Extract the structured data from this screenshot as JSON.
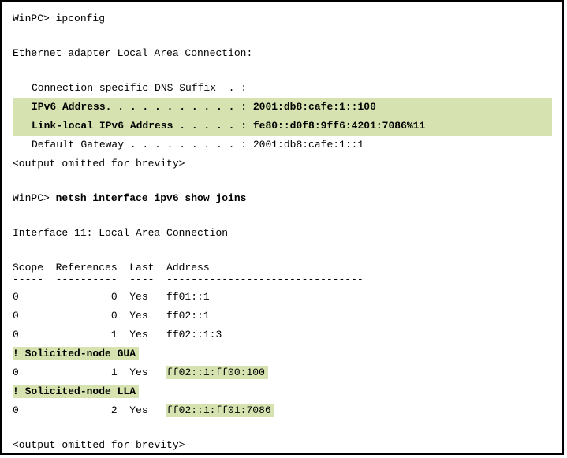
{
  "prompt1": "WinPC> ",
  "cmd1": "ipconfig",
  "adapter_header": "Ethernet adapter Local Area Connection:",
  "dns_suffix": "Connection-specific DNS Suffix  . :",
  "ipv6_line": "IPv6 Address. . . . . . . . . . . : 2001:db8:cafe:1::100",
  "lla_line": "Link-local IPv6 Address . . . . . : fe80::d0f8:9ff6:4201:7086%11",
  "gw_line": "Default Gateway . . . . . . . . . : 2001:db8:cafe:1::1",
  "omit": "<output omitted for brevity>",
  "prompt2": "WinPC> ",
  "cmd2": "netsh interface ipv6 show joins",
  "iface_header": "Interface 11: Local Area Connection",
  "table_header": "Scope  References  Last  Address",
  "table_sep": "-----  ----------  ----  --------------------------------",
  "rows": [
    {
      "line": "0               0  Yes   ff01::1"
    },
    {
      "line": "0               0  Yes   ff02::1"
    },
    {
      "line": "0               1  Yes   ff02::1:3"
    }
  ],
  "sn_gua_label": "! Solicited-node GUA",
  "row_gua_prefix": "0               1  Yes   ",
  "row_gua_addr": "ff02::1:ff00:100",
  "sn_lla_label": "! Solicited-node LLA",
  "row_lla_prefix": "0               2  Yes   ",
  "row_lla_addr": "ff02::1:ff01:7086"
}
